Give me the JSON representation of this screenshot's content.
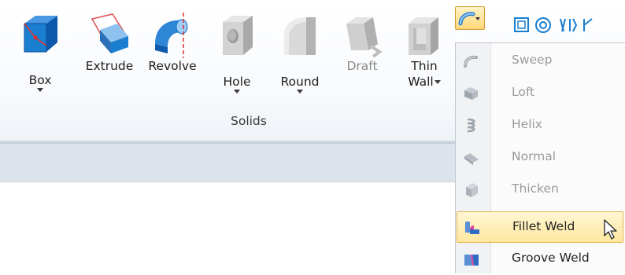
{
  "ribbon": {
    "tools": [
      {
        "label": "Box",
        "enabled": true,
        "dropdown": true
      },
      {
        "label": "Extrude",
        "enabled": true,
        "dropdown": false
      },
      {
        "label": "Revolve",
        "enabled": true,
        "dropdown": false
      },
      {
        "label": "Hole",
        "enabled": true,
        "dropdown": true
      },
      {
        "label": "Round",
        "enabled": true,
        "dropdown": true
      },
      {
        "label": "Draft",
        "enabled": false,
        "dropdown": false
      },
      {
        "label": "Thin",
        "label2": "Wall",
        "enabled": true,
        "dropdown": true
      }
    ],
    "group_label": "Solids"
  },
  "menu": {
    "items": [
      {
        "label": "Sweep",
        "enabled": false,
        "icon": "sweep-icon"
      },
      {
        "label": "Loft",
        "enabled": false,
        "icon": "loft-icon"
      },
      {
        "label": "Helix",
        "enabled": false,
        "icon": "helix-icon"
      },
      {
        "label": "Normal",
        "enabled": false,
        "icon": "normal-icon"
      },
      {
        "label": "Thicken",
        "enabled": false,
        "icon": "thicken-icon"
      },
      {
        "label": "Fillet Weld",
        "enabled": true,
        "highlighted": true,
        "icon": "fillet-weld-icon"
      },
      {
        "label": "Groove Weld",
        "enabled": true,
        "icon": "groove-weld-icon"
      }
    ]
  },
  "colors": {
    "accent_blue": "#1a7fd0",
    "highlight": "#ffe7a0",
    "highlight_border": "#e3b54a",
    "disabled_text": "#9a9a9a"
  }
}
